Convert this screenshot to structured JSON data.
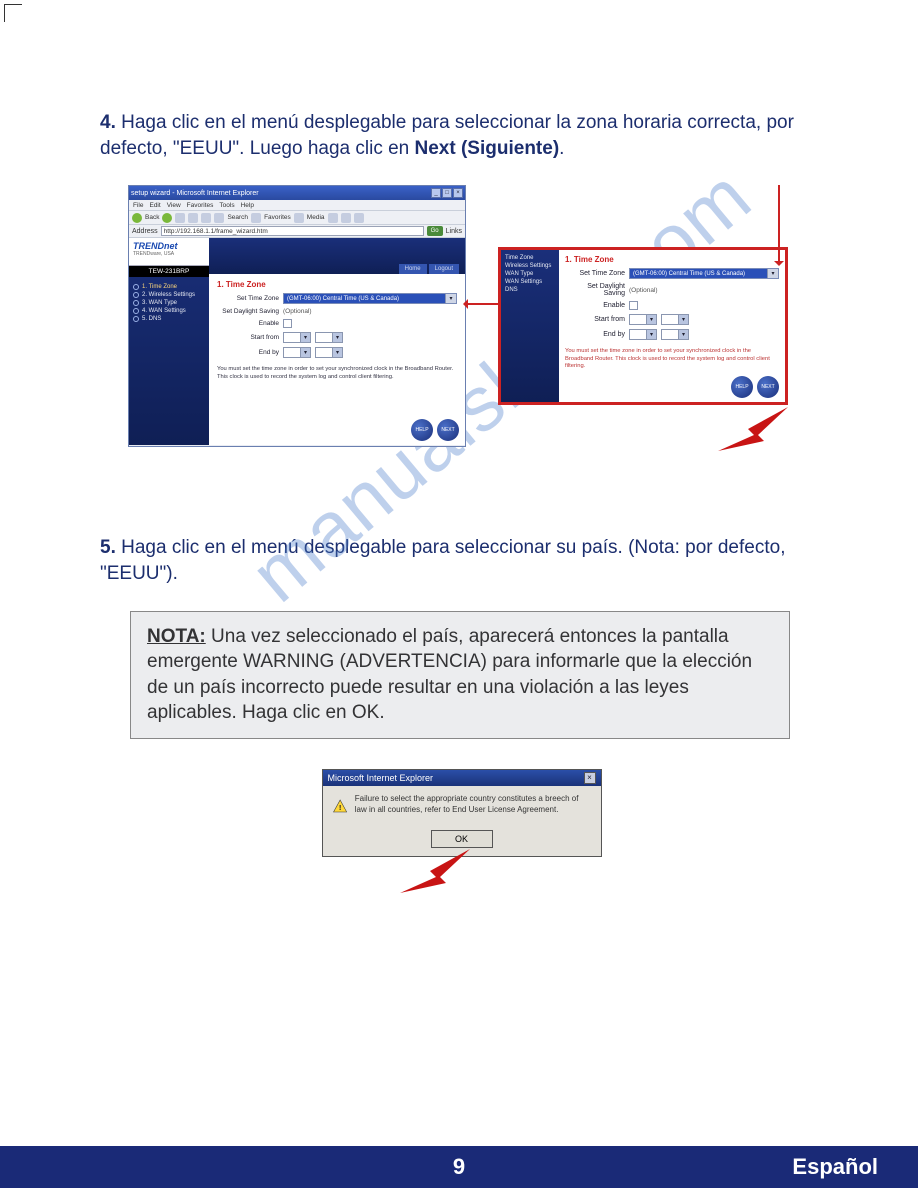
{
  "watermark": "manualshive.com",
  "step4": {
    "num": "4.",
    "text_part1": " Haga clic en el menú desplegable para seleccionar la zona horaria correcta, por defecto, \"EEUU\". Luego haga clic en ",
    "bold": "Next (Siguiente)",
    "tail": "."
  },
  "step5": {
    "num": "5.",
    "text": " Haga clic en el menú desplegable para seleccionar su país. (Nota: por defecto, \"EEUU\")."
  },
  "ie": {
    "title": "setup wizard - Microsoft Internet Explorer",
    "menu": [
      "File",
      "Edit",
      "View",
      "Favorites",
      "Tools",
      "Help"
    ],
    "toolbar": {
      "back": "Back",
      "search": "Search",
      "favorites": "Favorites",
      "media": "Media"
    },
    "address_label": "Address",
    "url": "http://192.168.1.1/frame_wizard.htm",
    "go": "Go",
    "links": "Links"
  },
  "router": {
    "brand": "TRENDnet",
    "brand_sub": "TRENDware, USA",
    "model": "TEW-231BRP",
    "nav": [
      {
        "label": "1. Time Zone"
      },
      {
        "label": "2. Wireless Settings"
      },
      {
        "label": "3. WAN Type"
      },
      {
        "label": "4. WAN Settings"
      },
      {
        "label": "5. DNS"
      }
    ],
    "tabs": {
      "home": "Home",
      "logout": "Logout"
    },
    "section_title": "1. Time Zone",
    "labels": {
      "set_tz": "Set Time Zone",
      "daylight": "Set Daylight Saving",
      "optional": "(Optional)",
      "enable": "Enable",
      "start": "Start from",
      "end": "End by"
    },
    "tz_value": "(GMT-06:00) Central Time (US & Canada)",
    "note": "You must set the time zone in order to set your synchronized clock in the Broadband Router. This clock is used to record the system log and control client filtering.",
    "buttons": {
      "help": "HELP",
      "next": "NEXT"
    }
  },
  "zoom_nav": [
    "Time Zone",
    "Wireless Settings",
    "WAN Type",
    "WAN Settings",
    "DNS"
  ],
  "note_box": {
    "label": "NOTA:",
    "text": " Una vez seleccionado el país, aparecerá entonces la pantalla emergente WARNING (ADVERTENCIA) para informarle que la elección de un país incorrecto puede resultar en una violación a las leyes aplicables. Haga clic en OK."
  },
  "dialog": {
    "title": "Microsoft Internet Explorer",
    "text": "Failure to select the appropriate country constitutes a breech of law in all countries, refer to End User License Agreement.",
    "ok": "OK"
  },
  "footer": {
    "page": "9",
    "lang": "Español"
  }
}
